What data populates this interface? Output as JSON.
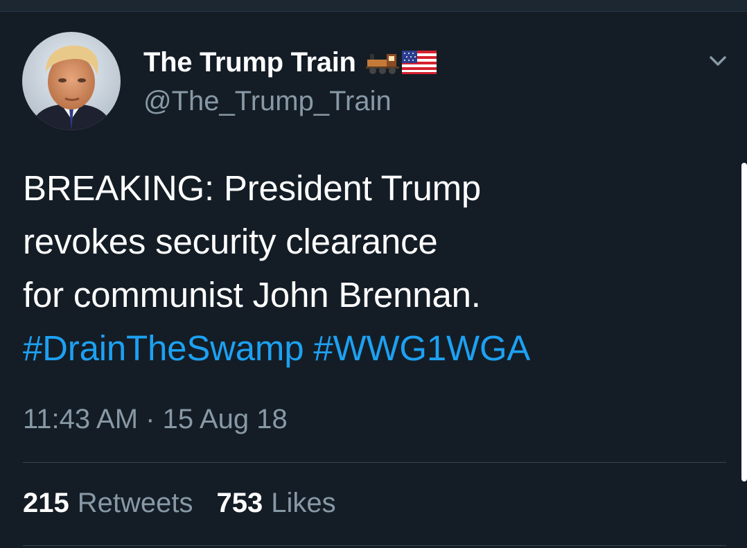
{
  "profile": {
    "display_name": "The Trump Train",
    "handle": "@The_Trump_Train",
    "name_icons": [
      "locomotive-icon",
      "us-flag-icon"
    ]
  },
  "tweet": {
    "lines": [
      "BREAKING: President Trump",
      "revokes security clearance",
      "for communist John Brennan."
    ],
    "hashtags": [
      "#DrainTheSwamp",
      "#WWG1WGA"
    ],
    "timestamp": "11:43 AM · 15 Aug 18"
  },
  "stats": {
    "retweets_count": "215",
    "retweets_label": "Retweets",
    "likes_count": "753",
    "likes_label": "Likes"
  },
  "colors": {
    "background": "#141d26",
    "text": "#ffffff",
    "secondary": "#8899a6",
    "link": "#1da1f2",
    "divider": "#38444d"
  },
  "icons": {
    "menu": "chevron-down-icon",
    "avatar": "profile-avatar"
  }
}
